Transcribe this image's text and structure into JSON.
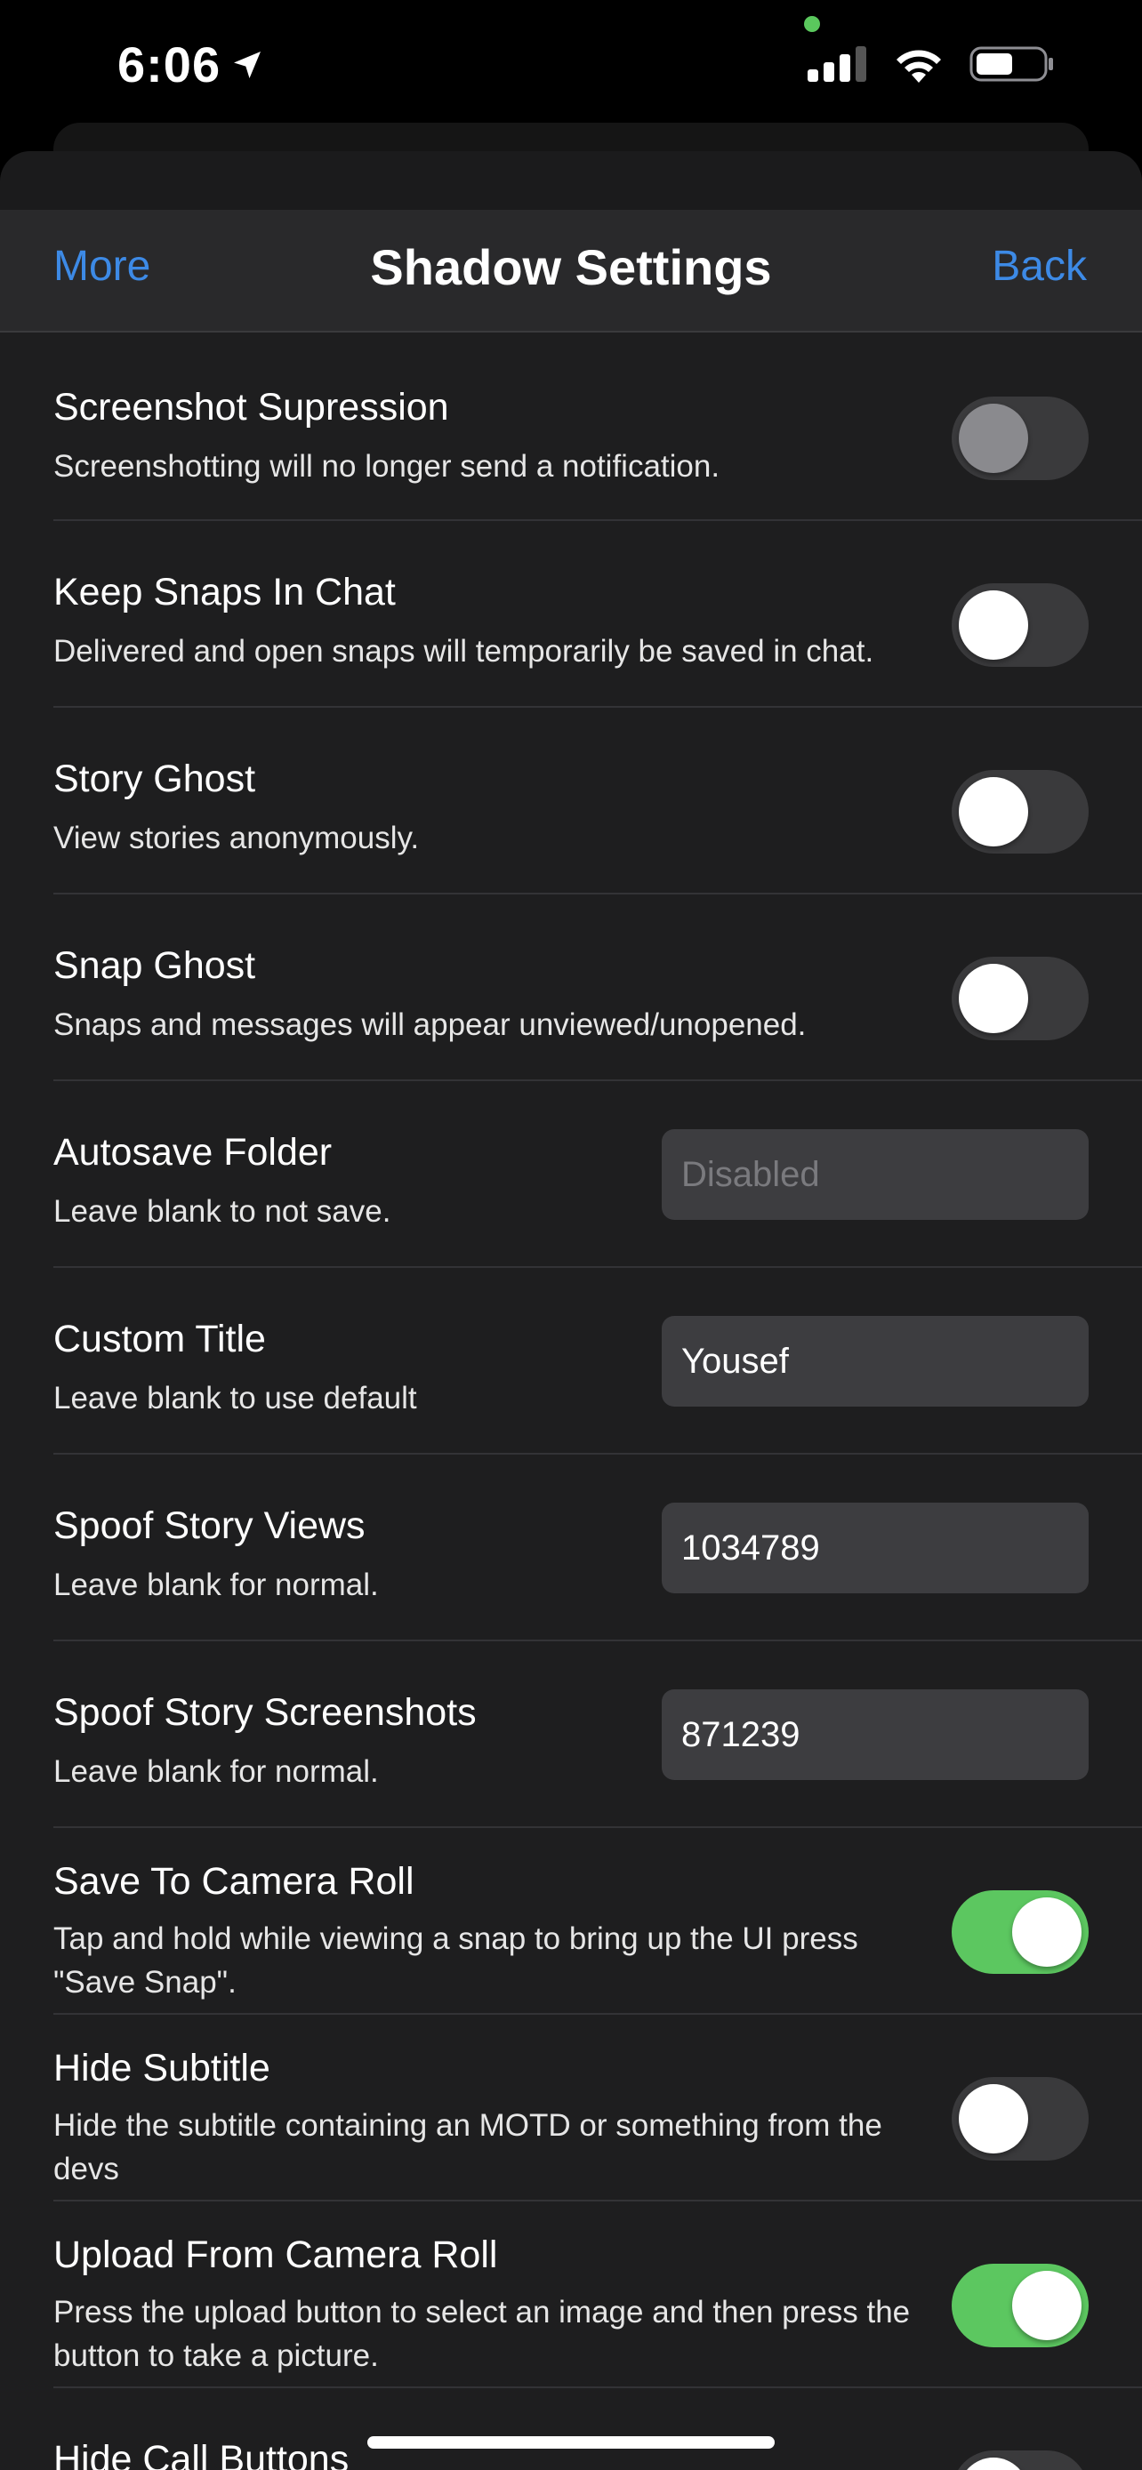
{
  "status_bar": {
    "time": "6:06"
  },
  "nav": {
    "left_label": "More",
    "title": "Shadow Settings",
    "right_label": "Back",
    "accent_color": "#3d8ae6"
  },
  "settings": [
    {
      "title": "Screenshot Supression",
      "subtitle": "Screenshotting will no longer send a notification.",
      "control": "toggle",
      "state": "off-disabled"
    },
    {
      "title": "Keep Snaps In Chat",
      "subtitle": "Delivered and open snaps will temporarily be saved in chat.",
      "control": "toggle",
      "state": "off"
    },
    {
      "title": "Story Ghost",
      "subtitle": "View stories anonymously.",
      "control": "toggle",
      "state": "off"
    },
    {
      "title": "Snap Ghost",
      "subtitle": "Snaps and messages will appear unviewed/unopened.",
      "control": "toggle",
      "state": "off"
    },
    {
      "title": "Autosave Folder",
      "subtitle": "Leave blank to not save.",
      "control": "text",
      "value": "",
      "placeholder": "Disabled"
    },
    {
      "title": "Custom Title",
      "subtitle": "Leave blank to use default",
      "control": "text",
      "value": "Yousef",
      "placeholder": ""
    },
    {
      "title": "Spoof Story Views",
      "subtitle": "Leave blank for normal.",
      "control": "text",
      "value": "1034789",
      "placeholder": ""
    },
    {
      "title": "Spoof Story Screenshots",
      "subtitle": "Leave blank for normal.",
      "control": "text",
      "value": "871239",
      "placeholder": ""
    },
    {
      "title": "Save To Camera Roll",
      "subtitle": "Tap and hold while viewing a snap to bring up the UI press \"Save Snap\".",
      "control": "toggle",
      "state": "on"
    },
    {
      "title": "Hide Subtitle",
      "subtitle": "Hide the subtitle containing an MOTD or something from the devs",
      "control": "toggle",
      "state": "off"
    },
    {
      "title": "Upload From Camera Roll",
      "subtitle": "Press the upload button to select an image and then press the button to take a picture.",
      "control": "toggle",
      "state": "on"
    },
    {
      "title": "Hide Call Buttons",
      "subtitle": "",
      "control": "toggle",
      "state": "off"
    }
  ],
  "colors": {
    "toggle_on": "#5cc760",
    "toggle_off": "#3a3a3c",
    "background": "#1e1e1f"
  }
}
